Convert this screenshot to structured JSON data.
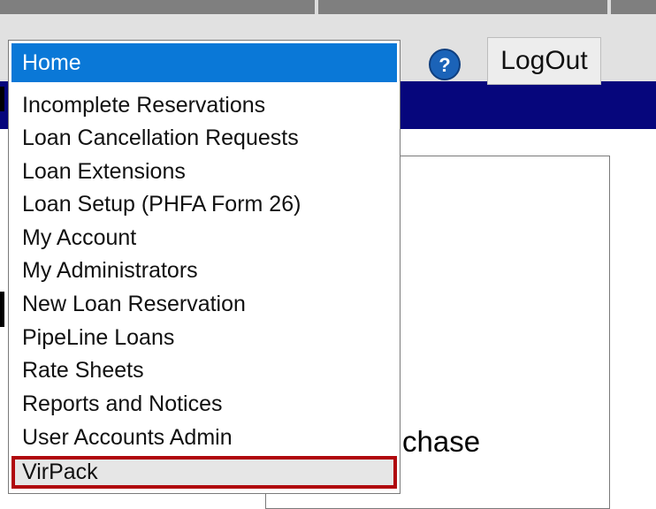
{
  "header": {
    "help_icon": "question-mark-icon",
    "logout_label": "LogOut"
  },
  "dropdown": {
    "selected": "Home",
    "options": [
      "Incomplete Reservations",
      "Loan Cancellation Requests",
      "Loan Extensions",
      "Loan Setup (PHFA Form 26)",
      "My Account",
      "My Administrators",
      "New Loan Reservation",
      "PipeLine Loans",
      "Rate Sheets",
      "Reports and Notices",
      "User Accounts Admin",
      "VirPack"
    ],
    "highlighted_option": "VirPack"
  },
  "page": {
    "partial_text": "chase"
  },
  "colors": {
    "selected_bg": "#0a78d7",
    "nav_band": "#06067c",
    "highlight_border": "#b0080d"
  }
}
